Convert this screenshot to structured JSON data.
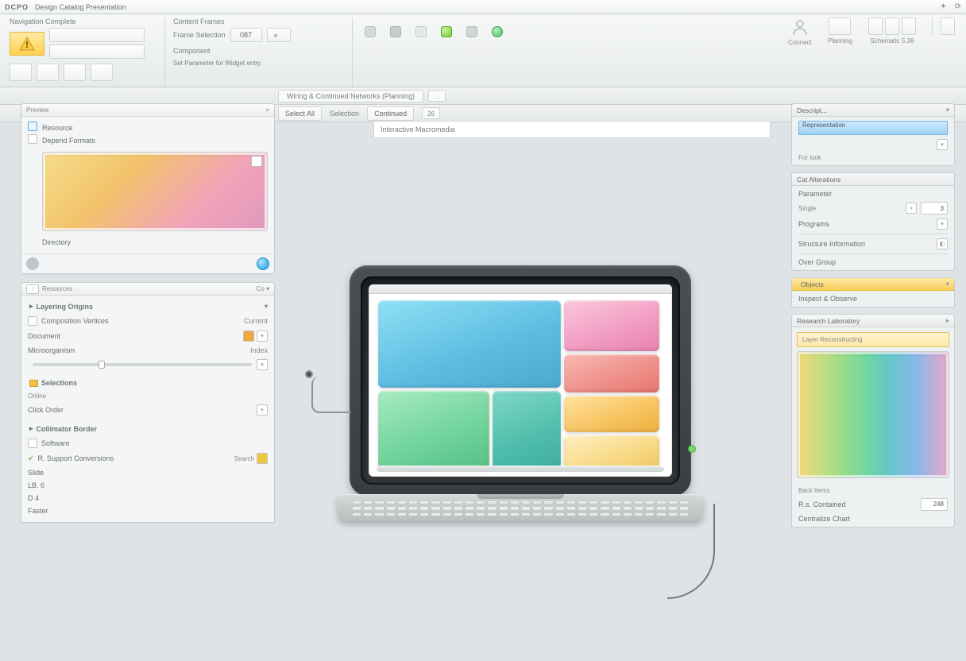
{
  "title": {
    "logo": "DCPO",
    "text": "Design Catalog Presentation"
  },
  "ribbon": {
    "group1": {
      "title": "Navigation Complete"
    },
    "group2": {
      "title": "Content Frames",
      "row1_label": "Frame Selection",
      "row1_btn": "087",
      "row2_label": "Component",
      "row2_text": "Set Parameter for Widget entry"
    },
    "opt_row": {
      "btn1": "Select All",
      "label": "Selection",
      "btn2": "Continued",
      "chip": "26"
    },
    "tabbar": {
      "t1": "Wiring & Continued Networks (Planning)"
    },
    "right": {
      "a": "Connect",
      "b": "Planning",
      "c": "Schematic 5.36"
    }
  },
  "crumb": "Interactive Macromedia",
  "left": {
    "p1": {
      "head": "Preview",
      "l1": "Resource",
      "l2": "Depend Formats",
      "l3": "Directory"
    },
    "p2": {
      "head": "Resources",
      "grp_a": "Layering Origins",
      "a1": "Composition Vertices",
      "a2": "Document",
      "a3": "Microorganism",
      "val1": "Current",
      "val2": "Index",
      "grp_b": "Selections",
      "b_hint": "Online",
      "b1": "Click Order",
      "grp_c": "Collimator Border",
      "c1": "Software",
      "c2": "R. Support Conversions",
      "c2v": "Search",
      "c3": "Slide",
      "c4": "LB. 6",
      "c5": "D 4",
      "c6": "Faster"
    }
  },
  "right_col": {
    "p1": {
      "head": "Descript...",
      "item": "Representation",
      "sub": "For look"
    },
    "p2": {
      "head": "Cat Alterations",
      "r1": "Parameter",
      "r1l": "Single",
      "r1v": "3",
      "r2": "Programs",
      "r3": "Structure Information",
      "r4": "Over Group"
    },
    "p3": {
      "head": "Objects",
      "r1": "Inspect & Observe"
    },
    "p4": {
      "head": "Research Laboratory",
      "grad_label": "Layer Reconstructing",
      "b1": "Back Items",
      "b2": "R.s. Contained",
      "b2v": "248",
      "b3": "Centralize Chart"
    }
  }
}
